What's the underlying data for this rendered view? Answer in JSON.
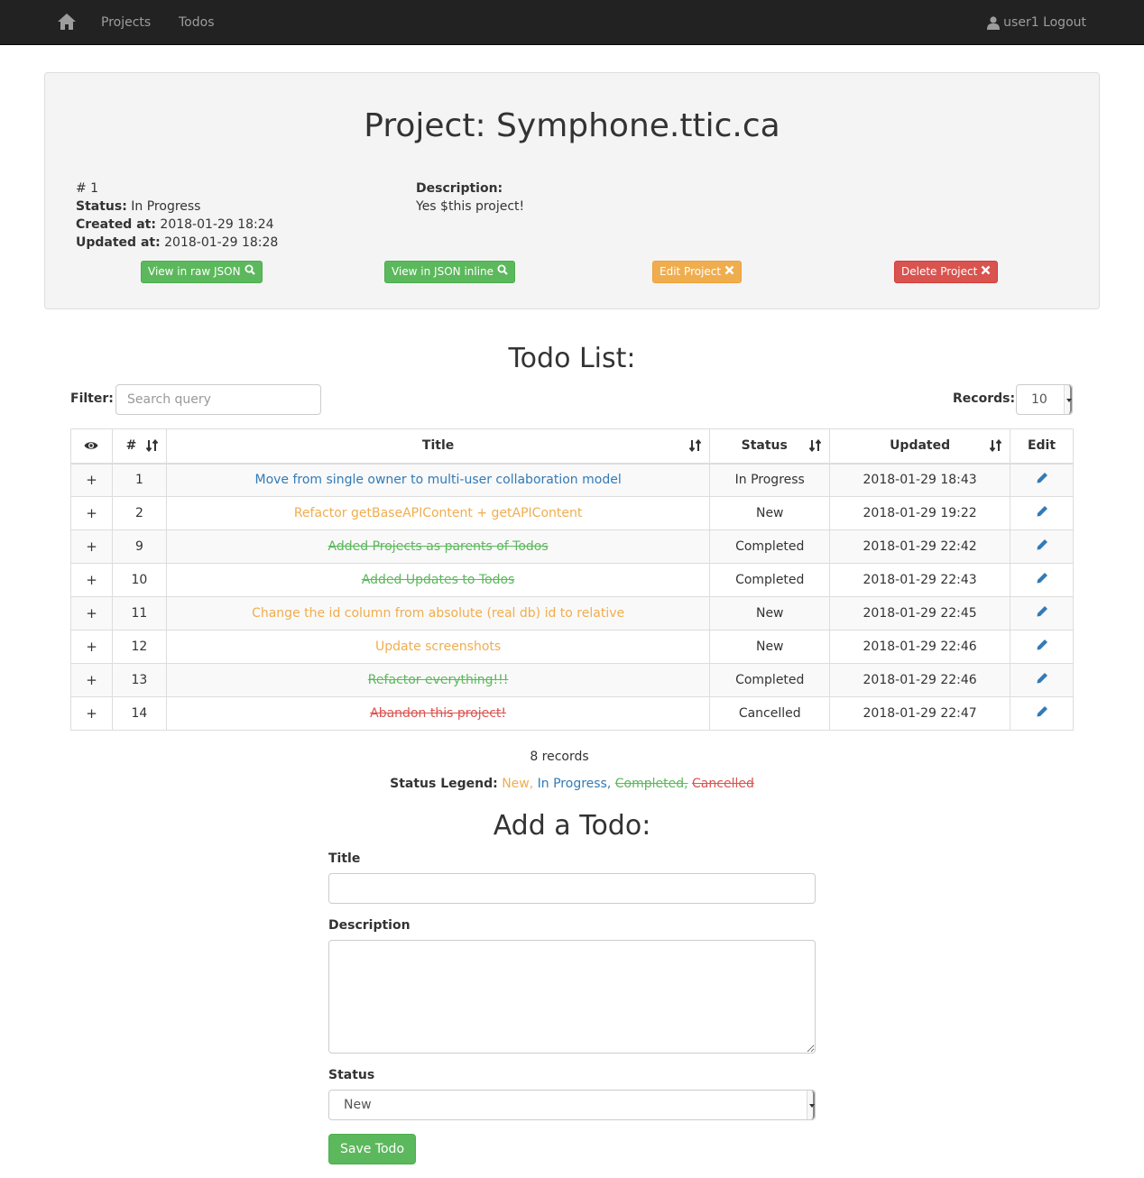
{
  "nav": {
    "home_icon": "home-icon",
    "projects_label": "Projects",
    "todos_label": "Todos",
    "user_label": "user1 Logout",
    "user_icon": "user-icon"
  },
  "project": {
    "title": "Project: Symphone.ttic.ca",
    "id_label": "# 1",
    "status_key": "Status:",
    "status_value": "In Progress",
    "created_key": "Created at:",
    "created_value": "2018-01-29 18:24",
    "updated_key": "Updated at:",
    "updated_value": "2018-01-29 18:28",
    "description_key": "Description:",
    "description_value": "Yes $this project!",
    "buttons": {
      "raw_json": "View in raw JSON",
      "inline_json": "View in JSON inline",
      "edit": "Edit Project",
      "delete": "Delete Project"
    }
  },
  "todo_list": {
    "heading": "Todo List:",
    "filter_label": "Filter:",
    "filter_placeholder": "Search query",
    "records_label": "Records:",
    "records_value": "10",
    "columns": {
      "num": "#",
      "title": "Title",
      "status": "Status",
      "updated": "Updated",
      "edit": "Edit"
    },
    "rows": [
      {
        "expand": "+",
        "num": "1",
        "title": "Move from single owner to multi-user collaboration model",
        "status": "In Progress",
        "updated": "2018-01-29 18:43"
      },
      {
        "expand": "+",
        "num": "2",
        "title": "Refactor getBaseAPIContent + getAPIContent",
        "status": "New",
        "updated": "2018-01-29 19:22"
      },
      {
        "expand": "+",
        "num": "9",
        "title": "Added Projects as parents of Todos",
        "status": "Completed",
        "updated": "2018-01-29 22:42"
      },
      {
        "expand": "+",
        "num": "10",
        "title": "Added Updates to Todos",
        "status": "Completed",
        "updated": "2018-01-29 22:43"
      },
      {
        "expand": "+",
        "num": "11",
        "title": "Change the id column from absolute (real db) id to relative",
        "status": "New",
        "updated": "2018-01-29 22:45"
      },
      {
        "expand": "+",
        "num": "12",
        "title": "Update screenshots",
        "status": "New",
        "updated": "2018-01-29 22:46"
      },
      {
        "expand": "+",
        "num": "13",
        "title": "Refactor everything!!!",
        "status": "Completed",
        "updated": "2018-01-29 22:46"
      },
      {
        "expand": "+",
        "num": "14",
        "title": "Abandon this project!",
        "status": "Cancelled",
        "updated": "2018-01-29 22:47"
      }
    ],
    "records_count": "8 records",
    "legend_label": "Status Legend:",
    "legend": {
      "new": "New,",
      "in_progress": "In Progress,",
      "completed": "Completed,",
      "cancelled": "Cancelled"
    }
  },
  "add_form": {
    "heading": "Add a Todo:",
    "title_label": "Title",
    "title_value": "",
    "description_label": "Description",
    "description_value": "",
    "status_label": "Status",
    "status_value": "New",
    "save_label": "Save Todo"
  },
  "colors": {
    "new": "#f0ad4e",
    "in_progress": "#337ab7",
    "completed": "#5cb85c",
    "cancelled": "#d9534f",
    "navbar": "#222222"
  }
}
